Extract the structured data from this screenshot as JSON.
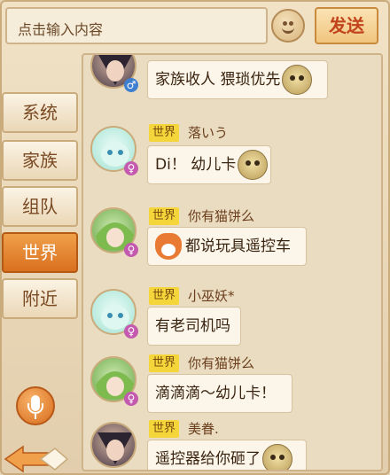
{
  "input": {
    "placeholder": "点击输入内容"
  },
  "toolbar": {
    "send_label": "发送"
  },
  "tabs": [
    {
      "label": "系统",
      "active": false
    },
    {
      "label": "家族",
      "active": false
    },
    {
      "label": "组队",
      "active": false
    },
    {
      "label": "世界",
      "active": true
    },
    {
      "label": "附近",
      "active": false
    }
  ],
  "colors": {
    "active_tab": "#d9701f",
    "channel_tag": "#f5d63a",
    "send_text": "#c1431b",
    "male": "#3f7fd0",
    "female": "#c35ab0"
  },
  "messages": [
    {
      "channel": "",
      "sender": "",
      "gender": "male",
      "avatar": "dark-hair-warrior",
      "text": "家族收人 猥琐优先",
      "sticker": "monkey-sticker"
    },
    {
      "channel": "世界",
      "sender": "落いう",
      "gender": "female",
      "avatar": "cyan-creature",
      "text": "Di！ 幼儿卡",
      "sticker": "monkey-sticker"
    },
    {
      "channel": "世界",
      "sender": "你有猫饼么",
      "gender": "female",
      "avatar": "green-hair-girl",
      "text": "都说玩具遥控车",
      "sticker": "fox-sticker"
    },
    {
      "channel": "世界",
      "sender": "小巫妖*",
      "gender": "female",
      "avatar": "cyan-creature",
      "text": "有老司机吗",
      "sticker": ""
    },
    {
      "channel": "世界",
      "sender": "你有猫饼么",
      "gender": "female",
      "avatar": "green-hair-girl",
      "text": "滴滴滴～幼儿卡！",
      "sticker": ""
    },
    {
      "channel": "世界",
      "sender": "美眷.",
      "gender": "male",
      "avatar": "dark-hair-warrior",
      "text": "遥控器给你砸了",
      "sticker": "monkey-sticker"
    }
  ],
  "gender_symbols": {
    "male": "♂",
    "female": "♀"
  }
}
